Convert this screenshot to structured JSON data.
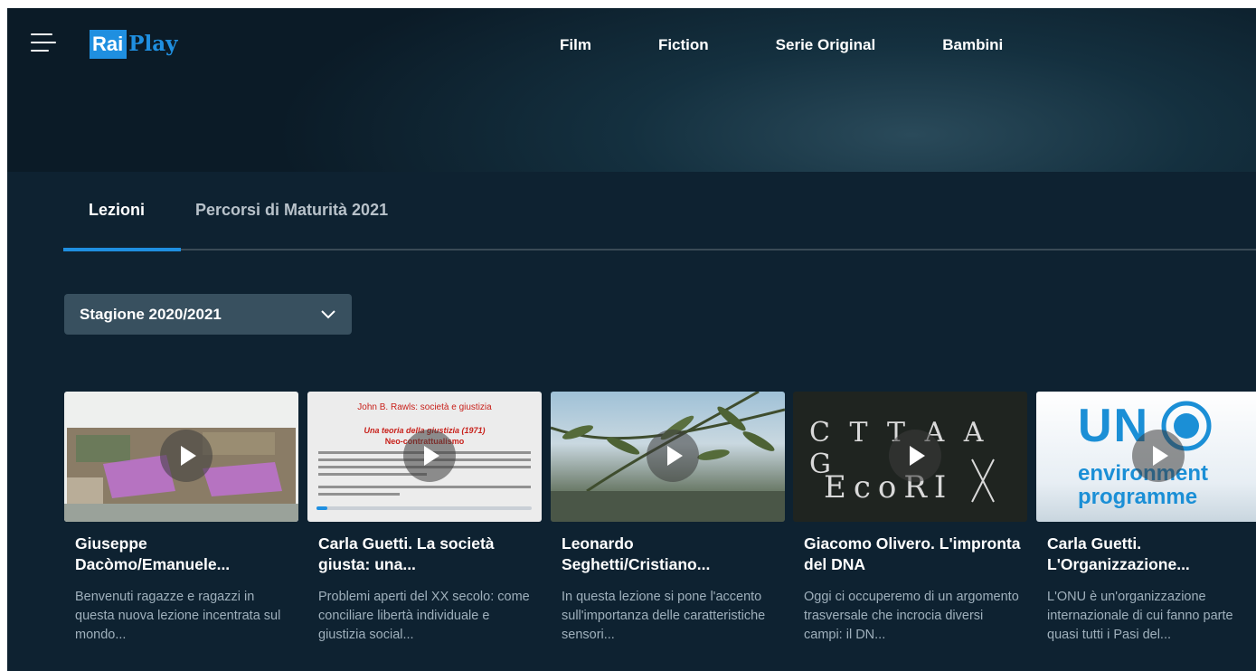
{
  "header": {
    "logo": {
      "rai": "Rai",
      "play": "Play"
    },
    "nav": [
      "Film",
      "Fiction",
      "Serie Original",
      "Bambini"
    ],
    "brand_color": "#1f8fe0"
  },
  "tabs": [
    {
      "label": "Lezioni",
      "active": true
    },
    {
      "label": "Percorsi di Maturità 2021",
      "active": false
    }
  ],
  "season_select": {
    "value": "Stagione 2020/2021"
  },
  "cards": [
    {
      "title": "Giuseppe Dacòmo/Emanuele...",
      "description": "Benvenuti ragazze e ragazzi in questa nuova lezione incentrata sul mondo..."
    },
    {
      "title": "Carla Guetti. La società giusta: una...",
      "description": "Problemi aperti del XX secolo: come conciliare libertà individuale e giustizia social...",
      "progress": 0.05,
      "thumb_text": {
        "title": "John B. Rawls: società e giustizia",
        "subtitle": "Una teoria della giustizia (1971)",
        "line": "Neo-contrattualismo"
      }
    },
    {
      "title": "Leonardo Seghetti/Cristiano...",
      "description": "In questa lezione si pone l'accento sull'importanza delle caratteristiche sensori..."
    },
    {
      "title": "Giacomo Olivero. L'impronta del DNA",
      "description": "Oggi ci occuperemo di un argomento trasversale che incrocia diversi campi: il DN...",
      "thumb_text": {
        "line1": "C T T A A G",
        "line2": "EcoRI"
      }
    },
    {
      "title": "Carla Guetti. L'Organizzazione...",
      "description": "L'ONU è un'organizzazione internazionale di cui fanno parte quasi tutti i Pasi del...",
      "thumb_text": {
        "un": "UN",
        "line1": "environment",
        "line2": "programme"
      }
    }
  ]
}
